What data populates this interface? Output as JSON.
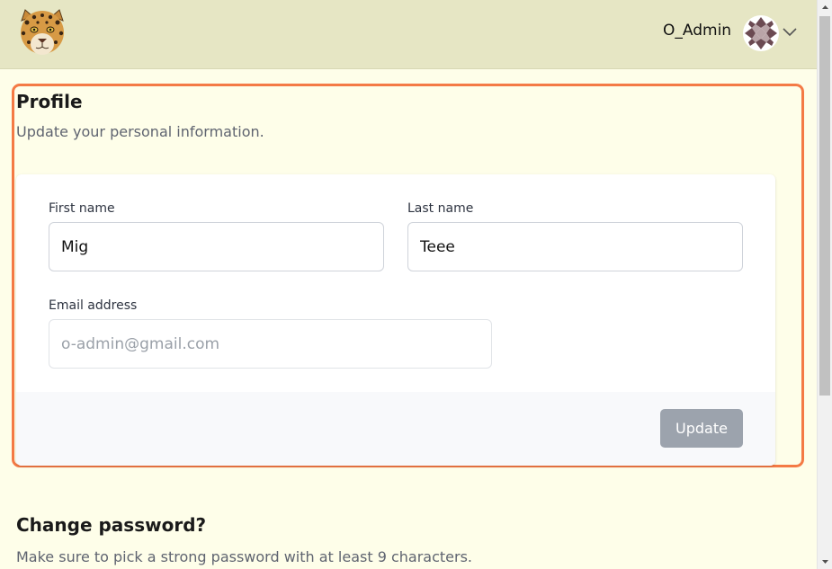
{
  "header": {
    "username": "O_Admin"
  },
  "profile": {
    "title": "Profile",
    "subtitle": "Update your personal information.",
    "first_name_label": "First name",
    "first_name_value": "Mig",
    "last_name_label": "Last name",
    "last_name_value": "Teee",
    "email_label": "Email address",
    "email_placeholder": "o-admin@gmail.com",
    "update_label": "Update"
  },
  "password": {
    "title": "Change password?",
    "subtitle": "Make sure to pick a strong password with at least 9 characters."
  },
  "colors": {
    "page_bg": "#fefee9",
    "header_bg": "#e6e6c4",
    "focus_ring": "#f47a45",
    "button_disabled": "#9ca3ad"
  }
}
